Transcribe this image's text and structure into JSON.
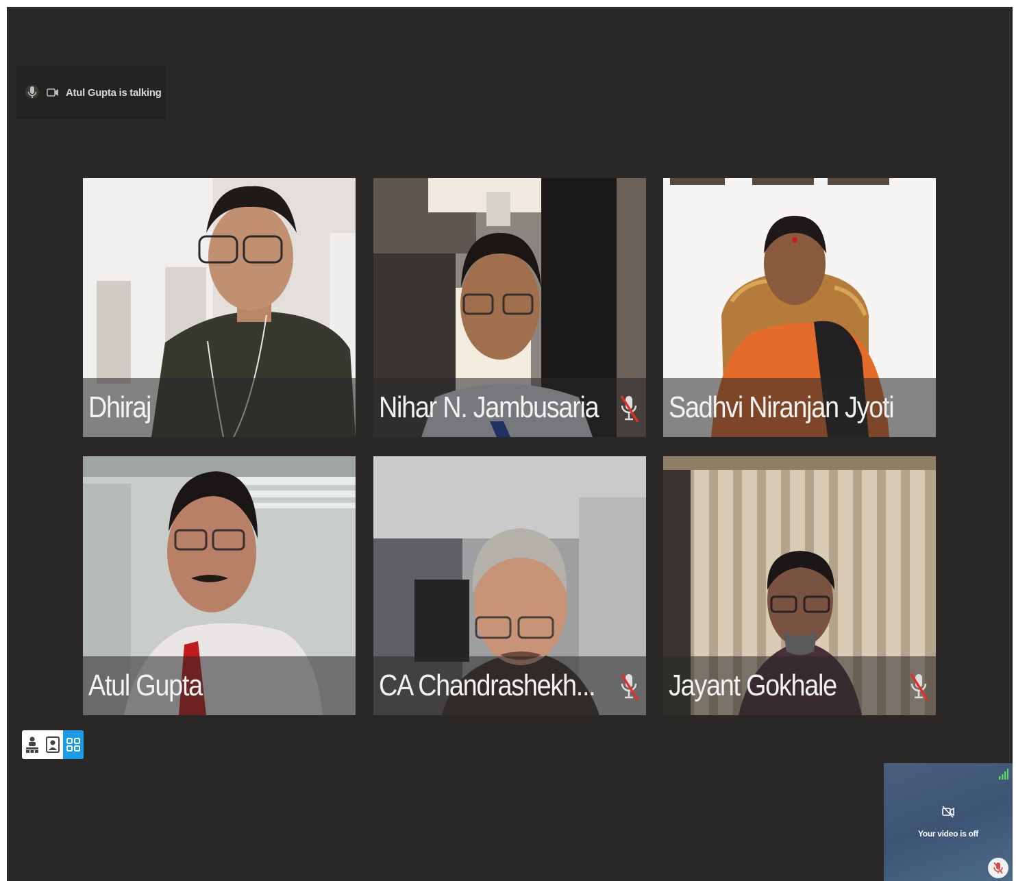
{
  "status_bar": {
    "talking_text": "Atul Gupta is talking",
    "icons": [
      "microphone-icon",
      "video-camera-icon"
    ]
  },
  "participants": [
    {
      "name": "Dhiraj",
      "muted": false
    },
    {
      "name": "Nihar N. Jambusaria",
      "muted": true
    },
    {
      "name": "Sadhvi Niranjan Jyoti",
      "muted": false
    },
    {
      "name": "Atul Gupta",
      "muted": false
    },
    {
      "name": "CA Chandrashekh...",
      "muted": true
    },
    {
      "name": "Jayant Gokhale",
      "muted": true
    }
  ],
  "layout_switcher": {
    "options": [
      "presenter-layout-icon",
      "speaker-layout-icon",
      "grid-layout-icon"
    ],
    "active": "grid-layout-icon"
  },
  "self_view": {
    "message": "Your video is off",
    "icons": [
      "camera-off-icon",
      "signal-strength-icon",
      "mic-muted-icon"
    ]
  },
  "colors": {
    "background": "#292826",
    "active_layout": "#1a9be8",
    "mute_slash": "#e0302a"
  }
}
